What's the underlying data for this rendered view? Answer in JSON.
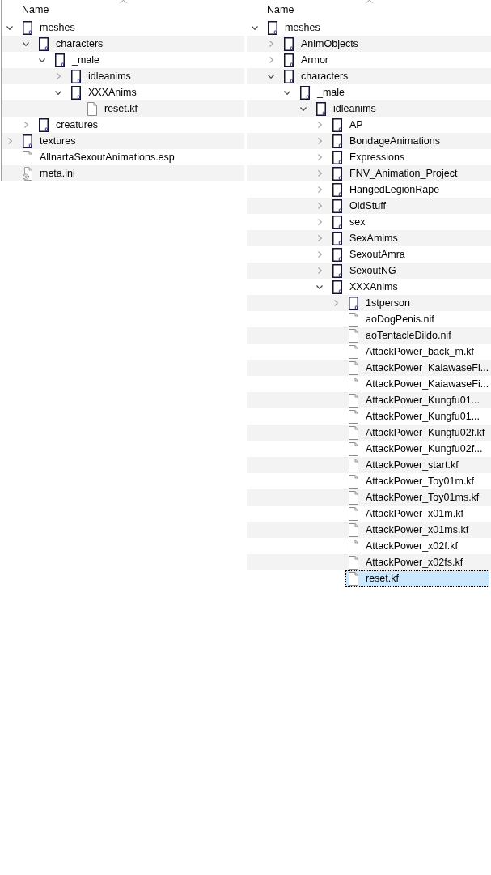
{
  "panels": [
    {
      "header": {
        "label": "Name"
      },
      "tree": [
        {
          "label": "meshes",
          "kind": "folder",
          "expanded": true,
          "selected": false,
          "children": [
            {
              "label": "characters",
              "kind": "folder",
              "expanded": true,
              "selected": false,
              "children": [
                {
                  "label": "_male",
                  "kind": "folder",
                  "expanded": true,
                  "selected": false,
                  "children": [
                    {
                      "label": "idleanims",
                      "kind": "folder",
                      "expanded": false,
                      "selected": false
                    },
                    {
                      "label": "XXXAnims",
                      "kind": "folder",
                      "expanded": true,
                      "selected": false,
                      "children": [
                        {
                          "label": "reset.kf",
                          "kind": "file",
                          "selected": false
                        }
                      ]
                    }
                  ]
                }
              ]
            },
            {
              "label": "creatures",
              "kind": "folder",
              "expanded": false,
              "selected": false
            }
          ]
        },
        {
          "label": "textures",
          "kind": "folder",
          "expanded": false,
          "selected": false
        },
        {
          "label": "AllnartaSexoutAnimations.esp",
          "kind": "file",
          "selected": false
        },
        {
          "label": "meta.ini",
          "kind": "config",
          "selected": false
        }
      ]
    },
    {
      "header": {
        "label": "Name"
      },
      "tree": [
        {
          "label": "meshes",
          "kind": "folder",
          "expanded": true,
          "selected": false,
          "children": [
            {
              "label": "AnimObjects",
              "kind": "folder",
              "expanded": false,
              "selected": false
            },
            {
              "label": "Armor",
              "kind": "folder",
              "expanded": false,
              "selected": false
            },
            {
              "label": "characters",
              "kind": "folder",
              "expanded": true,
              "selected": false,
              "children": [
                {
                  "label": "_male",
                  "kind": "folder",
                  "expanded": true,
                  "selected": false,
                  "children": [
                    {
                      "label": "idleanims",
                      "kind": "folder",
                      "expanded": true,
                      "selected": false,
                      "children": [
                        {
                          "label": "AP",
                          "kind": "folder",
                          "expanded": false,
                          "selected": false
                        },
                        {
                          "label": "BondageAnimations",
                          "kind": "folder",
                          "expanded": false,
                          "selected": false
                        },
                        {
                          "label": "Expressions",
                          "kind": "folder",
                          "expanded": false,
                          "selected": false
                        },
                        {
                          "label": "FNV_Animation_Project",
                          "kind": "folder",
                          "expanded": false,
                          "selected": false
                        },
                        {
                          "label": "HangedLegionRape",
                          "kind": "folder",
                          "expanded": false,
                          "selected": false
                        },
                        {
                          "label": "OldStuff",
                          "kind": "folder",
                          "expanded": false,
                          "selected": false
                        },
                        {
                          "label": "sex",
                          "kind": "folder",
                          "expanded": false,
                          "selected": false
                        },
                        {
                          "label": "SexAmims",
                          "kind": "folder",
                          "expanded": false,
                          "selected": false
                        },
                        {
                          "label": "SexoutAmra",
                          "kind": "folder",
                          "expanded": false,
                          "selected": false
                        },
                        {
                          "label": "SexoutNG",
                          "kind": "folder",
                          "expanded": false,
                          "selected": false
                        },
                        {
                          "label": "XXXAnims",
                          "kind": "folder",
                          "expanded": true,
                          "selected": false,
                          "children": [
                            {
                              "label": "1stperson",
                              "kind": "folder",
                              "expanded": false,
                              "selected": false
                            },
                            {
                              "label": "aoDogPenis.nif",
                              "kind": "file",
                              "selected": false
                            },
                            {
                              "label": "aoTentacleDildo.nif",
                              "kind": "file",
                              "selected": false
                            },
                            {
                              "label": "AttackPower_back_m.kf",
                              "kind": "file",
                              "selected": false
                            },
                            {
                              "label": "AttackPower_KaiawaseFi...",
                              "kind": "file",
                              "selected": false
                            },
                            {
                              "label": "AttackPower_KaiawaseFi...",
                              "kind": "file",
                              "selected": false
                            },
                            {
                              "label": "AttackPower_Kungfu01...",
                              "kind": "file",
                              "selected": false
                            },
                            {
                              "label": "AttackPower_Kungfu01...",
                              "kind": "file",
                              "selected": false
                            },
                            {
                              "label": "AttackPower_Kungfu02f.kf",
                              "kind": "file",
                              "selected": false
                            },
                            {
                              "label": "AttackPower_Kungfu02f...",
                              "kind": "file",
                              "selected": false
                            },
                            {
                              "label": "AttackPower_start.kf",
                              "kind": "file",
                              "selected": false
                            },
                            {
                              "label": "AttackPower_Toy01m.kf",
                              "kind": "file",
                              "selected": false
                            },
                            {
                              "label": "AttackPower_Toy01ms.kf",
                              "kind": "file",
                              "selected": false
                            },
                            {
                              "label": "AttackPower_x01m.kf",
                              "kind": "file",
                              "selected": false
                            },
                            {
                              "label": "AttackPower_x01ms.kf",
                              "kind": "file",
                              "selected": false
                            },
                            {
                              "label": "AttackPower_x02f.kf",
                              "kind": "file",
                              "selected": false
                            },
                            {
                              "label": "AttackPower_x02fs.kf",
                              "kind": "file",
                              "selected": false
                            },
                            {
                              "label": "reset.kf",
                              "kind": "file",
                              "selected": true
                            }
                          ]
                        }
                      ]
                    }
                  ]
                }
              ]
            }
          ]
        }
      ]
    }
  ]
}
